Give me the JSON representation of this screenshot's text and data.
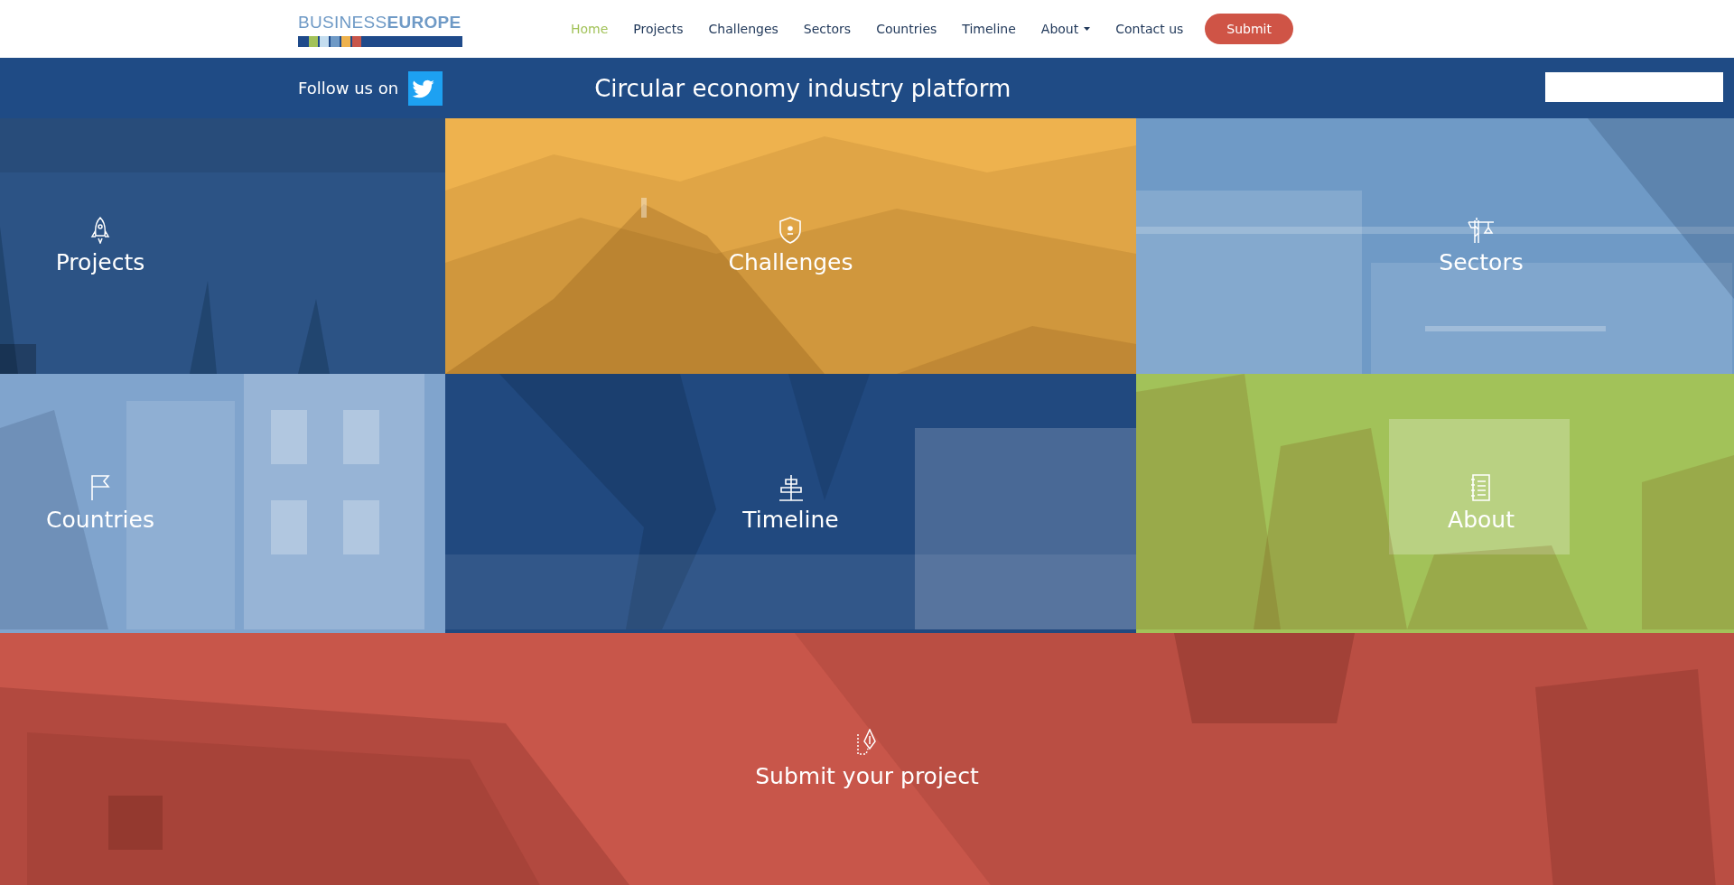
{
  "header": {
    "logo": "BUSINESS**EUROPE**",
    "nav": [
      {
        "label": "Home",
        "selected": true
      },
      {
        "label": "Projects",
        "selected": false
      },
      {
        "label": "Challenges",
        "selected": false
      },
      {
        "label": "Sectors",
        "selected": false
      },
      {
        "label": "Countries",
        "selected": false
      },
      {
        "label": "Timeline",
        "selected": false
      },
      {
        "label": "About",
        "selected": false,
        "dropdown": true
      },
      {
        "label": "Contact us",
        "selected": false
      }
    ],
    "submit_button": "Submit"
  },
  "banner": {
    "follow": "Follow us on",
    "title": "Circular economy industry platform",
    "search_field": true
  },
  "tiles": [
    {
      "label": "Projects",
      "color": "#2c5385"
    },
    {
      "label": "Challenges",
      "color": "#eeb24e"
    },
    {
      "label": "Sectors",
      "color": "#6f9ac6"
    },
    {
      "label": "Countries",
      "color": "#80a4cd"
    },
    {
      "label": "Timeline",
      "color": "#21497f"
    },
    {
      "label": "About",
      "color": "#a2c259"
    }
  ],
  "submit_tile": {
    "label": "Submit your project",
    "color": "#c8564a"
  }
}
